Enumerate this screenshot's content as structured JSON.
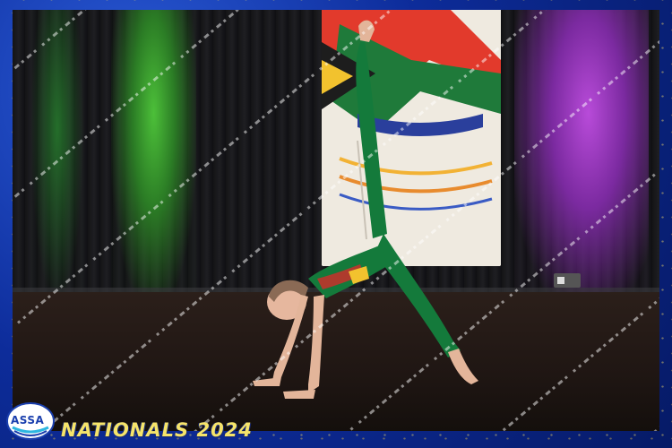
{
  "logo": {
    "text": "ASSA"
  },
  "caption": {
    "text": "NATIONALS 2024"
  },
  "watermark": {
    "text": "IMRAAN PHOTOGRAPHY"
  },
  "colors": {
    "frame": "#0d2c9a",
    "caption": "#f6e46a",
    "costume": "#17803f",
    "curtain_green": "#4cbf39",
    "curtain_purple": "#b84bd9"
  }
}
